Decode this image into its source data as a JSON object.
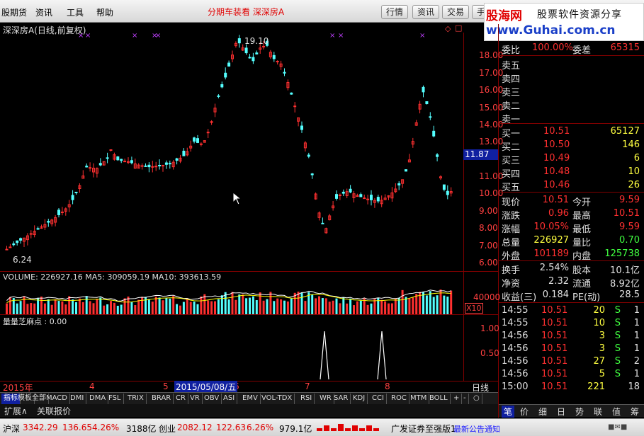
{
  "menu": {
    "items": [
      "股期货",
      "资讯",
      "工具",
      "帮助"
    ],
    "window_title": "分期车装看   深深房A"
  },
  "top_buttons": [
    "行情",
    "资讯",
    "交易",
    "手"
  ],
  "logo": {
    "brand": "股海网",
    "slogan": "股票软件资源分享",
    "url": "www.Guhai.com.cn"
  },
  "chart": {
    "title": "深深房A(日线,前复权)",
    "price_labels": [
      "18.00",
      "17.00",
      "16.00",
      "15.00",
      "14.00",
      "13.00",
      "12.00",
      "11.00",
      "10.00",
      "9.00",
      "8.00",
      "7.00",
      "6.00"
    ],
    "current_price_tag": "11.87",
    "high_mark": "19.10",
    "low_mark": "6.24",
    "volume_header": "VOLUME: 226927.16  MA5: 309059.19  MA10: 393613.59",
    "volume_axis": "40000",
    "volume_unit": "X10",
    "indicator_header": "量量芝麻点 : 0.00",
    "indicator_axis": [
      "1.00",
      "0.50"
    ],
    "time_axis": {
      "year": "2015年",
      "months": [
        "4",
        "5",
        "6",
        "7",
        "8"
      ],
      "cursor_date": "2015/05/08/五",
      "period": "日线"
    }
  },
  "tabs": [
    "指标",
    "模板",
    "全部",
    "MACD",
    "DMI",
    "DMA",
    "FSL",
    "TRIX",
    "BRAR",
    "CR",
    "VR",
    "OBV",
    "ASI",
    "EMV",
    "VOL-TDX",
    "RSI",
    "WR",
    "SAR",
    "KDJ",
    "CCI",
    "ROC",
    "MTM",
    "BOLL",
    "+",
    "-",
    "○"
  ],
  "subtabs": [
    "扩展∧",
    "关联报价"
  ],
  "quote": {
    "weibi_label": "委比",
    "weibi_value": "100.00%",
    "weicha_label": "委差",
    "weicha_value": "65315",
    "sell": [
      {
        "label": "卖五",
        "price": "",
        "vol": ""
      },
      {
        "label": "卖四",
        "price": "",
        "vol": ""
      },
      {
        "label": "卖三",
        "price": "",
        "vol": ""
      },
      {
        "label": "卖二",
        "price": "",
        "vol": ""
      },
      {
        "label": "卖一",
        "price": "",
        "vol": ""
      }
    ],
    "buy": [
      {
        "label": "买一",
        "price": "10.51",
        "vol": "65127"
      },
      {
        "label": "买二",
        "price": "10.50",
        "vol": "146"
      },
      {
        "label": "买三",
        "price": "10.49",
        "vol": "6"
      },
      {
        "label": "买四",
        "price": "10.48",
        "vol": "10"
      },
      {
        "label": "买五",
        "price": "10.46",
        "vol": "26"
      }
    ],
    "stats": [
      {
        "l1": "现价",
        "v1": "10.51",
        "l2": "今开",
        "v2": "9.59",
        "c1": "#ff3030",
        "c2": "#ff3030"
      },
      {
        "l1": "涨跌",
        "v1": "0.96",
        "l2": "最高",
        "v2": "10.51",
        "c1": "#ff3030",
        "c2": "#ff3030"
      },
      {
        "l1": "涨幅",
        "v1": "10.05%",
        "l2": "最低",
        "v2": "9.59",
        "c1": "#ff3030",
        "c2": "#ff3030"
      },
      {
        "l1": "总量",
        "v1": "226927",
        "l2": "量比",
        "v2": "0.70",
        "c1": "#ffff40",
        "c2": "#40ff40"
      },
      {
        "l1": "外盘",
        "v1": "101189",
        "l2": "内盘",
        "v2": "125738",
        "c1": "#ff3030",
        "c2": "#40ff40"
      }
    ],
    "fund": [
      {
        "l1": "换手",
        "v1": "2.54%",
        "l2": "股本",
        "v2": "10.1亿"
      },
      {
        "l1": "净资",
        "v1": "2.32",
        "l2": "流通",
        "v2": "8.92亿"
      },
      {
        "l1": "收益(三)",
        "v1": "0.184",
        "l2": "PE(动)",
        "v2": "28.5"
      }
    ],
    "ticks": [
      {
        "time": "14:55",
        "price": "10.51",
        "vol": "20",
        "side": "S",
        "n": "1"
      },
      {
        "time": "14:55",
        "price": "10.51",
        "vol": "10",
        "side": "S",
        "n": "1"
      },
      {
        "time": "14:56",
        "price": "10.51",
        "vol": "3",
        "side": "S",
        "n": "1"
      },
      {
        "time": "14:56",
        "price": "10.51",
        "vol": "3",
        "side": "S",
        "n": "1"
      },
      {
        "time": "14:56",
        "price": "10.51",
        "vol": "27",
        "side": "S",
        "n": "2"
      },
      {
        "time": "14:56",
        "price": "10.51",
        "vol": "5",
        "side": "S",
        "n": "1"
      },
      {
        "time": "15:00",
        "price": "10.51",
        "vol": "221",
        "side": "",
        "n": "18"
      }
    ],
    "bottom_tabs": [
      "笔",
      "价",
      "细",
      "日",
      "势",
      "联",
      "值",
      "筹"
    ]
  },
  "status": {
    "sh_label": "沪深",
    "sh_index": "3342.29",
    "sh_change": "136.65",
    "sh_pct": "4.26%",
    "sh_amount": "3188亿",
    "cy_label": "创业",
    "cy_index": "2082.12",
    "cy_change": "122.63",
    "cy_pct": "6.26%",
    "cy_amount": "979.1亿",
    "broker": "广发证券至强版1",
    "ticker": "最新公告通知"
  },
  "colors": {
    "up": "#ff3030",
    "down": "#54ffff",
    "axis": "#800000",
    "ma5": "#ffffff",
    "ma10": "#ffff00"
  }
}
